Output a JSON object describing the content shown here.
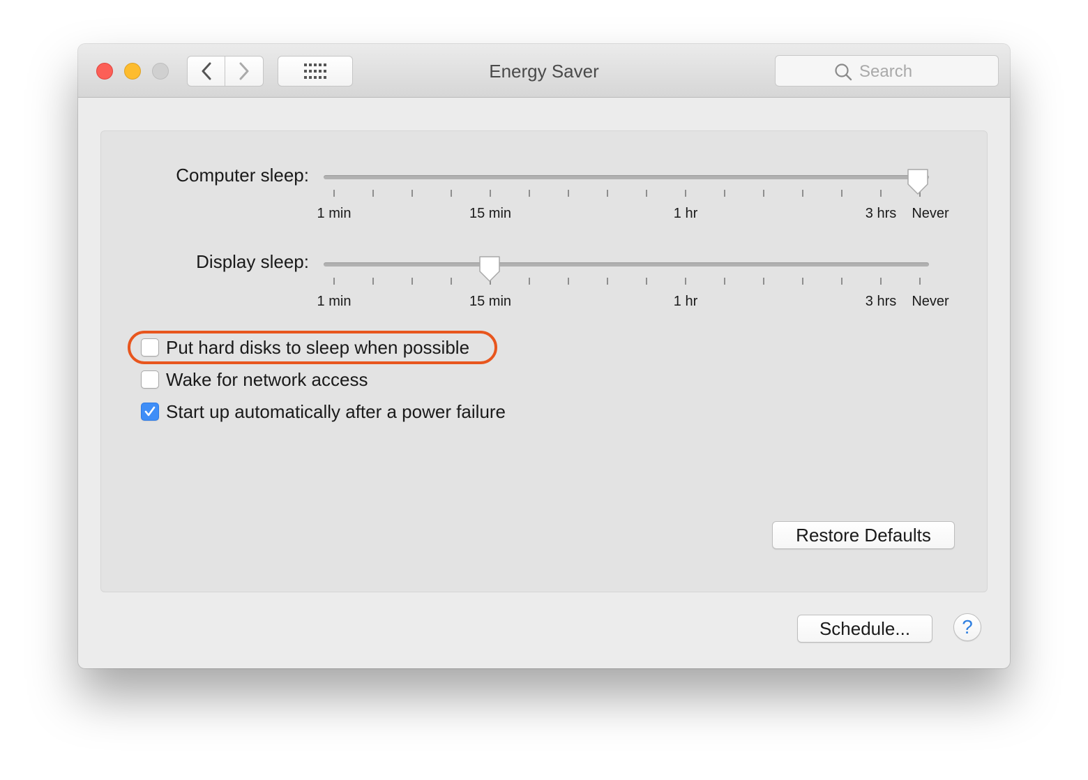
{
  "window": {
    "title": "Energy Saver",
    "search": {
      "placeholder": "Search",
      "icon": "magnifying-glass"
    },
    "toolbar": {
      "back_icon": "chevron-left",
      "forward_icon": "chevron-right",
      "show_all_icon": "grid-dots"
    },
    "traffic_lights": {
      "close": "#fc5f57",
      "minimize": "#fdbc2e",
      "zoom": "#d0d0d0"
    }
  },
  "computer_sleep": {
    "label": "Computer sleep:",
    "value": "Never",
    "ticks": [
      "1 min",
      "15 min",
      "1 hr",
      "3 hrs",
      "Never"
    ]
  },
  "display_sleep": {
    "label": "Display sleep:",
    "value": "15 min",
    "ticks": [
      "1 min",
      "15 min",
      "1 hr",
      "3 hrs",
      "Never"
    ]
  },
  "options": [
    {
      "label": "Put hard disks to sleep when possible",
      "checked": false,
      "highlighted": true
    },
    {
      "label": "Wake for network access",
      "checked": false
    },
    {
      "label": "Start up automatically after a power failure",
      "checked": true
    }
  ],
  "buttons": {
    "restore_defaults": "Restore Defaults",
    "schedule": "Schedule...",
    "help": "?"
  },
  "colors": {
    "highlight": "#e8561e",
    "checkbox_checked": "#3f8ef7",
    "help_icon": "#2f7fe0"
  }
}
